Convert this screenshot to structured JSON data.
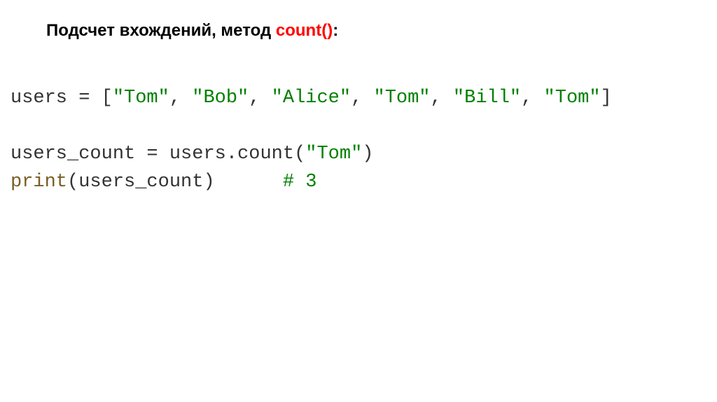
{
  "heading": {
    "prefix": "Подсчет вхождений, метод ",
    "method": "count()",
    "suffix": ":"
  },
  "code": {
    "l1_var": "users = [",
    "l1_s1": "\"Tom\"",
    "l1_c1": ", ",
    "l1_s2": "\"Bob\"",
    "l1_c2": ", ",
    "l1_s3": "\"Alice\"",
    "l1_c3": ", ",
    "l1_s4": "\"Tom\"",
    "l1_c4": ", ",
    "l1_s5": "\"Bill\"",
    "l1_c5": ", ",
    "l1_s6": "\"Tom\"",
    "l1_end": "]",
    "blank": "",
    "l3_a": "users_count = users.count(",
    "l3_s": "\"Tom\"",
    "l3_b": ")",
    "l4_fn": "print",
    "l4_a": "(users_count)      ",
    "l4_cmt": "# 3"
  }
}
